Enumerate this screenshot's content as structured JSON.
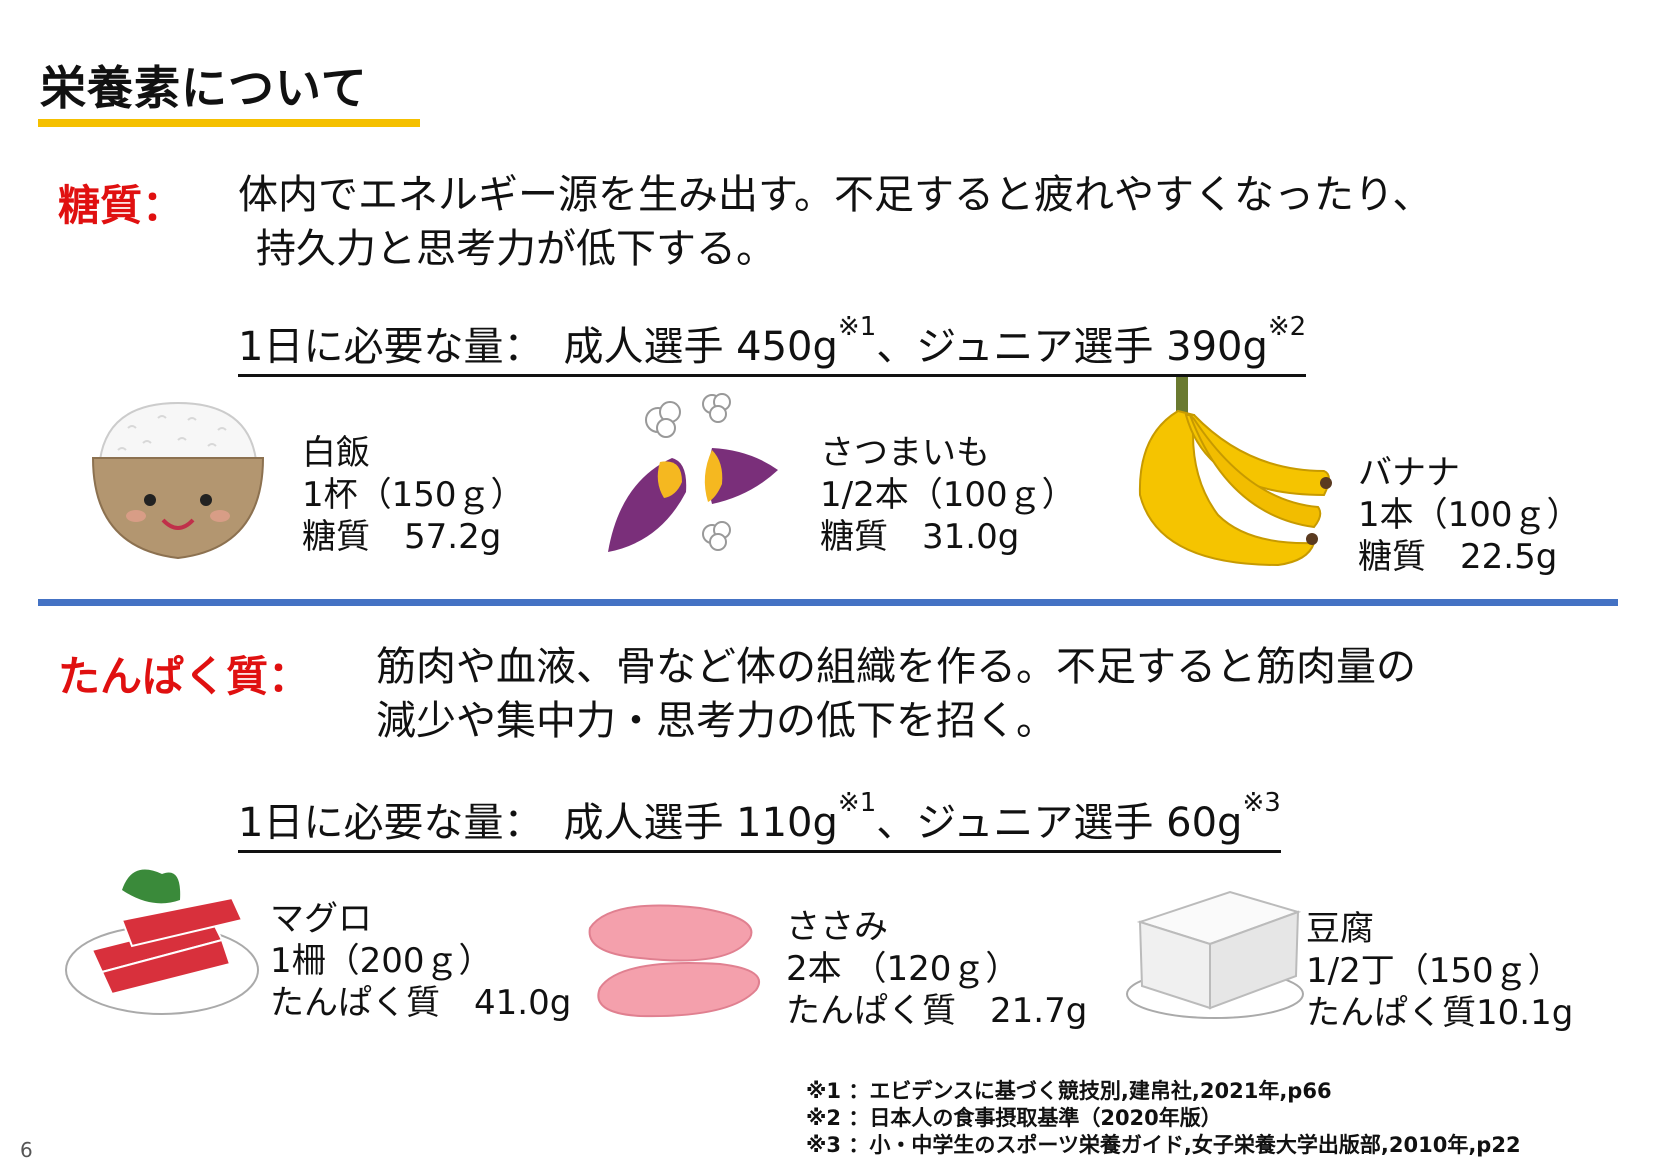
{
  "title": "栄養素について",
  "carb": {
    "label": "糖質：",
    "desc_line1": "体内でエネルギー源を生み出す。不足すると疲れやすくなったり、",
    "desc_line2": "持久力と思考力が低下する。",
    "req_prefix": "1日に必要な量：　成人選手 450g",
    "req_ref1": "※1",
    "req_mid": "、ジュニア選手 390g",
    "req_ref2": "※2",
    "foods": [
      {
        "name": "白飯",
        "amount": "1杯（150ｇ）",
        "nutrient": "糖質　57.2g"
      },
      {
        "name": "さつまいも",
        "amount": "1/2本（100ｇ）",
        "nutrient": "糖質　31.0g"
      },
      {
        "name": "バナナ",
        "amount": "1本（100ｇ）",
        "nutrient": "糖質　22.5g"
      }
    ]
  },
  "protein": {
    "label": "たんぱく質：",
    "desc_line1": "筋肉や血液、骨など体の組織を作る。不足すると筋肉量の",
    "desc_line2": "減少や集中力・思考力の低下を招く。",
    "req_prefix": "1日に必要な量：　成人選手 110g",
    "req_ref1": "※1",
    "req_mid": "、ジュニア選手 60g",
    "req_ref2": "※3",
    "foods": [
      {
        "name": "マグロ",
        "amount": "1柵（200ｇ）",
        "nutrient": "たんぱく質　41.0g"
      },
      {
        "name": "ささみ",
        "amount": "2本 （120ｇ）",
        "nutrient": "たんぱく質　21.7g"
      },
      {
        "name": "豆腐",
        "amount": "1/2丁（150ｇ）",
        "nutrient": "たんぱく質10.1g"
      }
    ]
  },
  "footnotes": [
    "※1 ：エビデンスに基づく競技別,建帛社,2021年,p66",
    "※2 ：日本人の食事摂取基準（2020年版）",
    "※3 ：小・中学生のスポーツ栄養ガイド,女子栄養大学出版部,2010年,p22"
  ],
  "page_number": "6",
  "colors": {
    "accent_yellow": "#f5c000",
    "divider_blue": "#4472c4",
    "label_red": "#e01010"
  }
}
